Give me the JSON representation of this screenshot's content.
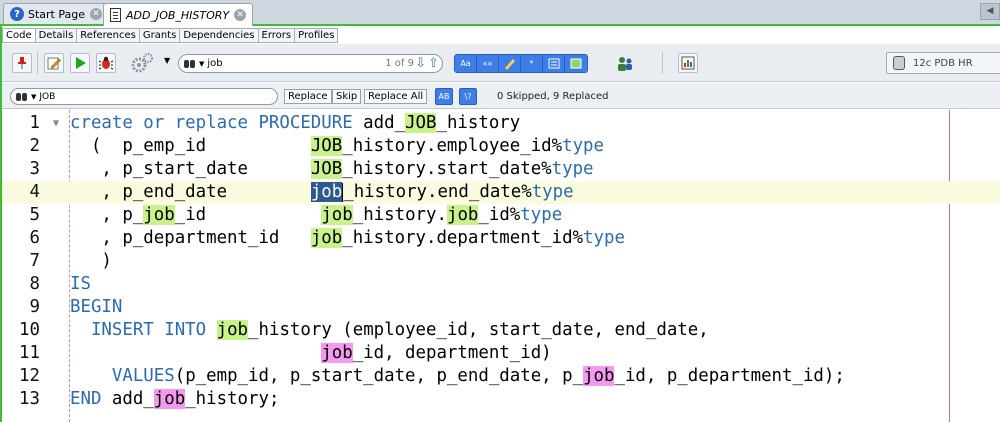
{
  "tabs": [
    {
      "label": "Start Page"
    },
    {
      "label": "ADD_JOB_HISTORY"
    }
  ],
  "subtabs": [
    "Code",
    "Details",
    "References",
    "Grants",
    "Dependencies",
    "Errors",
    "Profiles"
  ],
  "toolbar": {
    "search_value": "job",
    "search_count": "1 of 9",
    "connection": "12c PDB HR",
    "blue_buttons": [
      "Aa",
      "«»"
    ]
  },
  "replace": {
    "value": "JOB",
    "buttons": [
      "Replace",
      "Skip",
      "Replace All"
    ],
    "status": "0 Skipped, 9 Replaced"
  },
  "editor": {
    "current_line": 4,
    "lines": [
      {
        "n": "1",
        "s": [
          {
            "t": "create or replace PROCEDURE",
            "c": "kw"
          },
          {
            "t": " add_"
          },
          {
            "t": "JOB",
            "c": "hl-g"
          },
          {
            "t": "_history"
          }
        ]
      },
      {
        "n": "2",
        "s": [
          {
            "t": "  (  p_emp_id          "
          },
          {
            "t": "JOB",
            "c": "hl-g"
          },
          {
            "t": "_history.employee_id%"
          },
          {
            "t": "type",
            "c": "kw"
          }
        ]
      },
      {
        "n": "3",
        "s": [
          {
            "t": "   , p_start_date      "
          },
          {
            "t": "JOB",
            "c": "hl-g"
          },
          {
            "t": "_history.start_date%"
          },
          {
            "t": "type",
            "c": "kw"
          }
        ]
      },
      {
        "n": "4",
        "s": [
          {
            "t": "   , p_end_date        "
          },
          {
            "t": "job",
            "c": "hl-sel"
          },
          {
            "t": "",
            "c": "cursor"
          },
          {
            "t": "_history.end_date%"
          },
          {
            "t": "type",
            "c": "kw"
          }
        ]
      },
      {
        "n": "5",
        "s": [
          {
            "t": "   , p_"
          },
          {
            "t": "job",
            "c": "hl-g"
          },
          {
            "t": "_id           "
          },
          {
            "t": "job",
            "c": "hl-g"
          },
          {
            "t": "_history."
          },
          {
            "t": "job",
            "c": "hl-g"
          },
          {
            "t": "_id%"
          },
          {
            "t": "type",
            "c": "kw"
          }
        ]
      },
      {
        "n": "6",
        "s": [
          {
            "t": "   , p_department_id   "
          },
          {
            "t": "job",
            "c": "hl-g"
          },
          {
            "t": "_history.department_id%"
          },
          {
            "t": "type",
            "c": "kw"
          }
        ]
      },
      {
        "n": "7",
        "s": [
          {
            "t": "   )"
          }
        ]
      },
      {
        "n": "8",
        "s": [
          {
            "t": "IS",
            "c": "kw"
          }
        ]
      },
      {
        "n": "9",
        "s": [
          {
            "t": "BEGIN",
            "c": "kw"
          }
        ]
      },
      {
        "n": "10",
        "s": [
          {
            "t": "  "
          },
          {
            "t": "INSERT INTO",
            "c": "kw"
          },
          {
            "t": " "
          },
          {
            "t": "job",
            "c": "hl-g"
          },
          {
            "t": "_history (employee_id, start_date, end_date,"
          }
        ]
      },
      {
        "n": "11",
        "s": [
          {
            "t": "                        "
          },
          {
            "t": "job",
            "c": "hl-m"
          },
          {
            "t": "_id, department_id)"
          }
        ]
      },
      {
        "n": "12",
        "s": [
          {
            "t": "    "
          },
          {
            "t": "VALUES",
            "c": "kw"
          },
          {
            "t": "(p_emp_id, p_start_date, p_end_date, p_"
          },
          {
            "t": "job",
            "c": "hl-m"
          },
          {
            "t": "_id, p_department_id);"
          }
        ]
      },
      {
        "n": "13",
        "s": [
          {
            "t": "END",
            "c": "kw"
          },
          {
            "t": " add_"
          },
          {
            "t": "job",
            "c": "hl-m"
          },
          {
            "t": "_history;"
          }
        ]
      }
    ]
  }
}
